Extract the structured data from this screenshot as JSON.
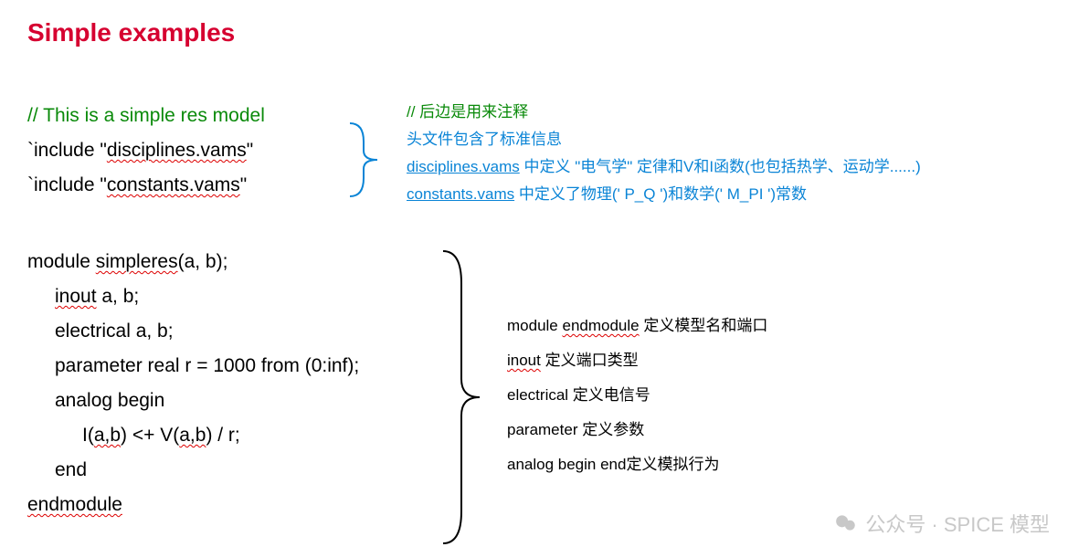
{
  "title": "Simple examples",
  "code_top": {
    "comment": "// This is a simple res model",
    "include1_pre": "`include \"",
    "include1_name": "disciplines.vams",
    "include1_post": "\"",
    "include2_pre": "`include \"",
    "include2_name": "constants.vams",
    "include2_post": "\""
  },
  "annotations_top": {
    "line1": "// 后边是用来注释",
    "line2": "头文件包含了标准信息",
    "line3_pre": "",
    "line3_link": "disciplines.vams",
    "line3_post": " 中定义 \"电气学\" 定律和V和I函数(也包括热学、运动学......)",
    "line4_link": "constants.vams",
    "line4_post": " 中定义了物理(' P_Q ')和数学(' M_PI ')常数"
  },
  "code_module": {
    "l1_pre": "module ",
    "l1_name": "simpleres",
    "l1_post": "(a, b);",
    "l2_kw": "inout",
    "l2_post": " a, b;",
    "l3": "electrical a, b;",
    "l4": "parameter real r = 1000 from (0:inf);",
    "l5": "analog begin",
    "l6_pre": "I(",
    "l6_ab1": "a,b",
    "l6_mid": ") <+ V(",
    "l6_ab2": "a,b",
    "l6_post": ") / r;",
    "l7": "end",
    "l8": "endmodule"
  },
  "annotations_module": {
    "a1_pre": "module  ",
    "a1_kw": "endmodule",
    "a1_post": " 定义模型名和端口",
    "a2_kw": "inout",
    "a2_post": " 定义端口类型",
    "a3": "electrical 定义电信号",
    "a4": "parameter 定义参数",
    "a5": "analog begin end定义模拟行为"
  },
  "watermark": {
    "text": "公众号 · SPICE 模型"
  }
}
